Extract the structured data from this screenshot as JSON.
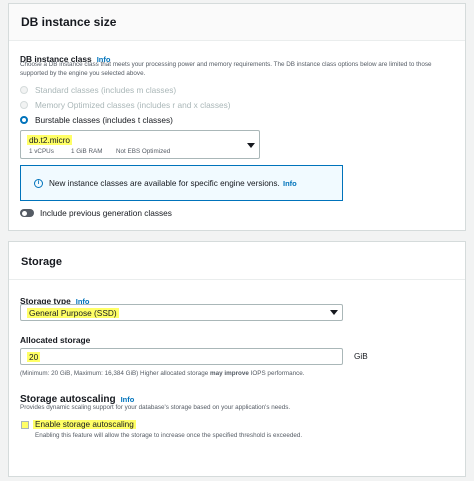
{
  "instance_panel": {
    "title": "DB instance size",
    "class_label": "DB instance class",
    "info": "Info",
    "description": "Choose a DB instance class that meets your processing power and memory requirements. The DB instance class options below are limited to those supported by the engine you selected above.",
    "options": [
      {
        "label": "Standard classes (includes m classes)",
        "state": "disabled"
      },
      {
        "label": "Memory Optimized classes (includes r and x classes)",
        "state": "disabled"
      },
      {
        "label": "Burstable classes (includes t classes)",
        "state": "checked"
      }
    ],
    "selected_class": "db.t2.micro",
    "class_details": {
      "vcpu": "1 vCPUs",
      "ram": "1 GiB RAM",
      "ebs": "Not EBS Optimized"
    },
    "notice_text": "New instance classes are available for specific engine versions.",
    "notice_info": "Info",
    "toggle_label": "Include previous generation classes"
  },
  "storage_panel": {
    "title": "Storage",
    "type_label": "Storage type",
    "type_info": "Info",
    "type_value": "General Purpose (SSD)",
    "allocated_label": "Allocated storage",
    "allocated_value": "20",
    "allocated_unit": "GiB",
    "hint_pre": "(Minimum: 20 GiB, Maximum: 16,384 GiB) Higher allocated storage ",
    "hint_bold": "may improve",
    "hint_post": " IOPS performance.",
    "autoscaling_title": "Storage autoscaling",
    "autoscaling_info": "Info",
    "autoscaling_desc": "Provides dynamic scaling support for your database's storage based on your application's needs.",
    "enable_label": "Enable storage autoscaling",
    "enable_desc": "Enabling this feature will allow the storage to increase once the specified threshold is exceeded."
  }
}
